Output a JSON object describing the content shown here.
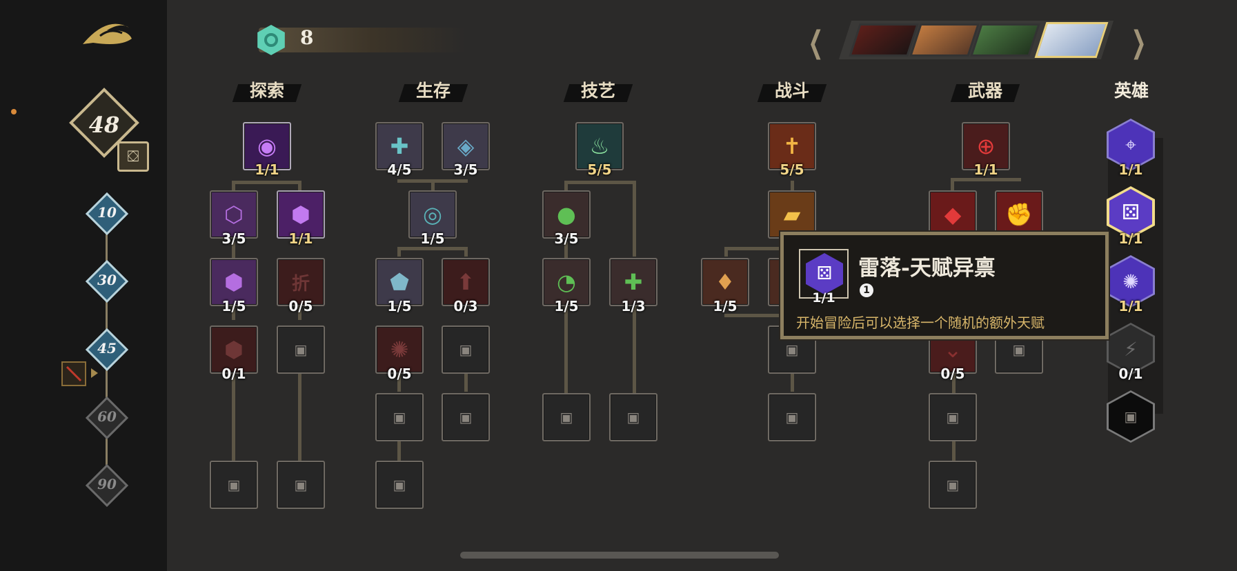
{
  "currency": {
    "amount": "8",
    "icon": "gem-icon"
  },
  "player": {
    "level": "48"
  },
  "level_milestones": [
    "10",
    "30",
    "45",
    "60",
    "90"
  ],
  "categories": [
    "探索",
    "生存",
    "技艺",
    "战斗",
    "武器",
    "英雄"
  ],
  "nodes": {
    "explore": [
      "1/1",
      "3/5",
      "1/1",
      "1/5",
      "0/5",
      "0/1"
    ],
    "survive": [
      "4/5",
      "3/5",
      "1/5",
      "1/5",
      "0/3",
      "0/5"
    ],
    "skill": [
      "5/5",
      "3/5",
      "1/5",
      "1/3"
    ],
    "combat": [
      "5/5",
      "1/5"
    ],
    "weapon": [
      "1/1",
      "0/5"
    ],
    "hero": [
      "1/1",
      "1/1",
      "1/1",
      "0/1"
    ]
  },
  "tooltip": {
    "title": "雷落-天赋异禀",
    "count": "1/1",
    "badge": "1",
    "description": "开始冒险后可以选择一个随机的额外天赋"
  },
  "locked_glyph": "折",
  "colors": {
    "accent_gold": "#d9b65f",
    "hero_purple": "#5b3cc4",
    "weapon_red": "#8a1f1f",
    "survive_teal": "#5ab3b8"
  }
}
